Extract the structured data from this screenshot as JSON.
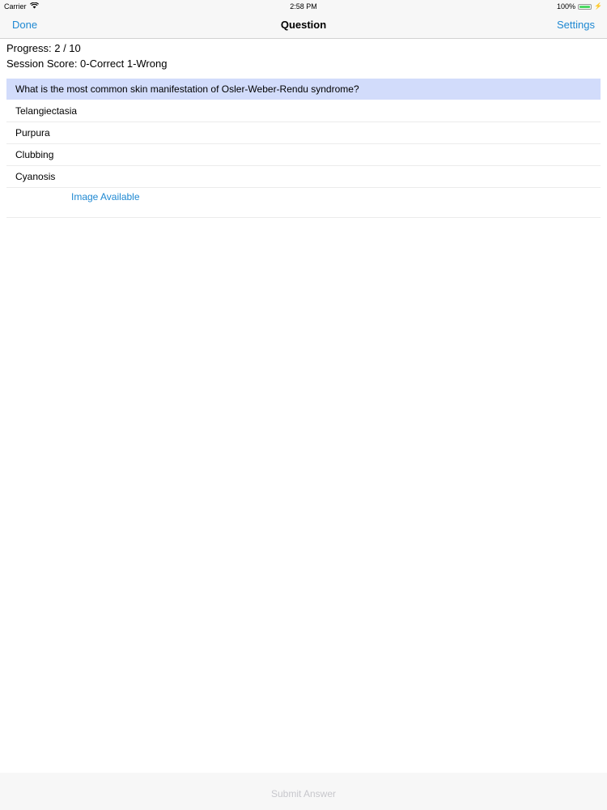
{
  "status_bar": {
    "carrier": "Carrier",
    "time": "2:58 PM",
    "battery": "100%",
    "battery_level": 1.0,
    "wifi_icon": "wifi-icon",
    "battery_icon": "battery-icon",
    "charging_icon": "charging-bolt-icon"
  },
  "nav": {
    "left_label": "Done",
    "title": "Question",
    "right_label": "Settings",
    "accent_color": "#1e88d2"
  },
  "progress": {
    "label": "Progress: 2 / 10",
    "current": 2,
    "total": 10
  },
  "score": {
    "label": "Session Score: 0-Correct 1-Wrong"
  },
  "question": {
    "text": "What is the most common skin manifestation of Osler-Weber-Rendu syndrome?",
    "highlight_color": "#d2dcfb"
  },
  "answers": [
    {
      "label": "Telangiectasia"
    },
    {
      "label": "Purpura"
    },
    {
      "label": "Clubbing"
    },
    {
      "label": "Cyanosis"
    }
  ],
  "image_link": {
    "label": "Image Available"
  },
  "toolbar": {
    "submit_label": "Submit Answer",
    "submit_color": "#c7c7cc"
  }
}
